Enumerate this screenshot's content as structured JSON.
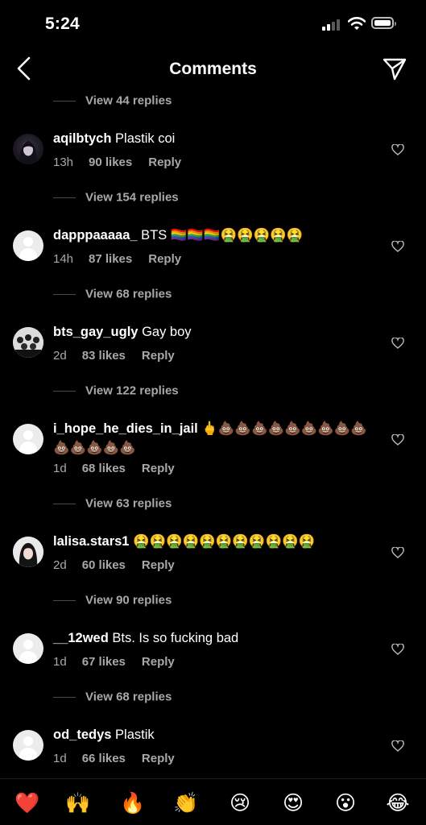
{
  "status_bar": {
    "time": "5:24"
  },
  "nav": {
    "title": "Comments",
    "back_icon": "chevron-left-icon",
    "share_icon": "paper-plane-icon"
  },
  "comments": [
    {
      "username": "aqilbtych",
      "text": "Plastik coi",
      "age": "13h",
      "likes": "90 likes",
      "reply": "Reply",
      "avatar": "anime-girl-avatar",
      "view_replies": "View 154 replies"
    },
    {
      "username": "dapppaaaaa_",
      "text": "BTS 🏳️‍🌈🏳️‍🌈🏳️‍🌈🤮🤮🤮🤮🤮",
      "age": "14h",
      "likes": "87 likes",
      "reply": "Reply",
      "avatar": "default-avatar",
      "view_replies": "View 68 replies"
    },
    {
      "username": "bts_gay_ugly",
      "text": "Gay boy",
      "age": "2d",
      "likes": "83 likes",
      "reply": "Reply",
      "avatar": "group-photo-avatar",
      "view_replies": "View 122 replies"
    },
    {
      "username": "i_hope_he_dies_in_jail",
      "text": "🖕💩💩💩💩💩💩💩💩💩💩💩💩💩💩",
      "age": "1d",
      "likes": "68 likes",
      "reply": "Reply",
      "avatar": "default-avatar",
      "view_replies": "View 63 replies"
    },
    {
      "username": "lalisa.stars1",
      "text": "🤮🤮🤮🤮🤮🤮🤮🤮🤮🤮🤮",
      "age": "2d",
      "likes": "60 likes",
      "reply": "Reply",
      "avatar": "portrait-avatar",
      "view_replies": "View 90 replies"
    },
    {
      "username": "__12wed",
      "text": "Bts. Is so fucking bad",
      "age": "1d",
      "likes": "67 likes",
      "reply": "Reply",
      "avatar": "default-avatar",
      "view_replies": "View 68 replies"
    },
    {
      "username": "od_tedys",
      "text": "Plastik",
      "age": "1d",
      "likes": "66 likes",
      "reply": "Reply",
      "avatar": "default-avatar"
    }
  ],
  "top_view_replies": "View 44 replies",
  "quick_reactions": [
    "❤️",
    "🙌",
    "🔥",
    "👏",
    "😢",
    "😍",
    "😮",
    "😂"
  ],
  "colors": {
    "background": "#000000",
    "text": "#ffffff",
    "secondary_text": "#a8a8a8"
  }
}
